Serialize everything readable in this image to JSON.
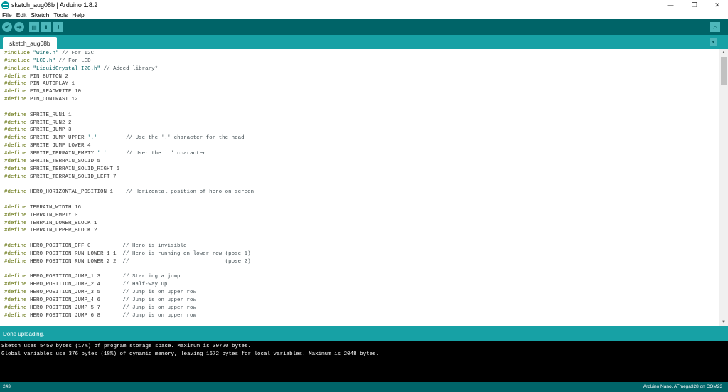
{
  "window": {
    "title": "sketch_aug08b | Arduino 1.8.2",
    "minimize_glyph": "—",
    "maximize_glyph": "❐",
    "close_glyph": "✕"
  },
  "menu": {
    "items": [
      "File",
      "Edit",
      "Sketch",
      "Tools",
      "Help"
    ]
  },
  "toolbar": {
    "verify_glyph": "✔",
    "upload_glyph": "➜",
    "new_glyph": "▤",
    "open_glyph": "⬆",
    "save_glyph": "⬇",
    "serial_glyph": "⌕"
  },
  "tabs": {
    "active": "sketch_aug08b",
    "menu_glyph": "▼"
  },
  "code_lines": [
    [
      [
        "kw",
        "#include"
      ],
      [
        "",
        " "
      ],
      [
        "str",
        "\"Wire.h\""
      ],
      [
        "",
        " "
      ],
      [
        "cm",
        "// For I2C"
      ]
    ],
    [
      [
        "kw",
        "#include"
      ],
      [
        "",
        " "
      ],
      [
        "str",
        "\"LCD.h\""
      ],
      [
        "",
        " "
      ],
      [
        "cm",
        "// For LCD"
      ]
    ],
    [
      [
        "kw",
        "#include"
      ],
      [
        "",
        " "
      ],
      [
        "str",
        "\"LiquidCrystal_I2C.h\""
      ],
      [
        "",
        " "
      ],
      [
        "cm",
        "// Added library*"
      ]
    ],
    [
      [
        "kw",
        "#define"
      ],
      [
        "",
        " PIN_BUTTON 2"
      ]
    ],
    [
      [
        "kw",
        "#define"
      ],
      [
        "",
        " PIN_AUTOPLAY 1"
      ]
    ],
    [
      [
        "kw",
        "#define"
      ],
      [
        "",
        " PIN_READWRITE 10"
      ]
    ],
    [
      [
        "kw",
        "#define"
      ],
      [
        "",
        " PIN_CONTRAST 12"
      ]
    ],
    [],
    [
      [
        "kw",
        "#define"
      ],
      [
        "",
        " SPRITE_RUN1 1"
      ]
    ],
    [
      [
        "kw",
        "#define"
      ],
      [
        "",
        " SPRITE_RUN2 2"
      ]
    ],
    [
      [
        "kw",
        "#define"
      ],
      [
        "",
        " SPRITE_JUMP 3"
      ]
    ],
    [
      [
        "kw",
        "#define"
      ],
      [
        "",
        " SPRITE_JUMP_UPPER "
      ],
      [
        "str",
        "'.'"
      ],
      [
        "",
        "         "
      ],
      [
        "cm",
        "// Use the '.' character for the head"
      ]
    ],
    [
      [
        "kw",
        "#define"
      ],
      [
        "",
        " SPRITE_JUMP_LOWER 4"
      ]
    ],
    [
      [
        "kw",
        "#define"
      ],
      [
        "",
        " SPRITE_TERRAIN_EMPTY "
      ],
      [
        "str",
        "' '"
      ],
      [
        "",
        "      "
      ],
      [
        "cm",
        "// User the ' ' character"
      ]
    ],
    [
      [
        "kw",
        "#define"
      ],
      [
        "",
        " SPRITE_TERRAIN_SOLID 5"
      ]
    ],
    [
      [
        "kw",
        "#define"
      ],
      [
        "",
        " SPRITE_TERRAIN_SOLID_RIGHT 6"
      ]
    ],
    [
      [
        "kw",
        "#define"
      ],
      [
        "",
        " SPRITE_TERRAIN_SOLID_LEFT 7"
      ]
    ],
    [],
    [
      [
        "kw",
        "#define"
      ],
      [
        "",
        " HERO_HORIZONTAL_POSITION 1    "
      ],
      [
        "cm",
        "// Horizontal position of hero on screen"
      ]
    ],
    [],
    [
      [
        "kw",
        "#define"
      ],
      [
        "",
        " TERRAIN_WIDTH 16"
      ]
    ],
    [
      [
        "kw",
        "#define"
      ],
      [
        "",
        " TERRAIN_EMPTY 0"
      ]
    ],
    [
      [
        "kw",
        "#define"
      ],
      [
        "",
        " TERRAIN_LOWER_BLOCK 1"
      ]
    ],
    [
      [
        "kw",
        "#define"
      ],
      [
        "",
        " TERRAIN_UPPER_BLOCK 2"
      ]
    ],
    [],
    [
      [
        "kw",
        "#define"
      ],
      [
        "",
        " HERO_POSITION_OFF 0          "
      ],
      [
        "cm",
        "// Hero is invisible"
      ]
    ],
    [
      [
        "kw",
        "#define"
      ],
      [
        "",
        " HERO_POSITION_RUN_LOWER_1 1  "
      ],
      [
        "cm",
        "// Hero is running on lower row (pose 1)"
      ]
    ],
    [
      [
        "kw",
        "#define"
      ],
      [
        "",
        " HERO_POSITION_RUN_LOWER_2 2  "
      ],
      [
        "cm",
        "//                              (pose 2)"
      ]
    ],
    [],
    [
      [
        "kw",
        "#define"
      ],
      [
        "",
        " HERO_POSITION_JUMP_1 3       "
      ],
      [
        "cm",
        "// Starting a jump"
      ]
    ],
    [
      [
        "kw",
        "#define"
      ],
      [
        "",
        " HERO_POSITION_JUMP_2 4       "
      ],
      [
        "cm",
        "// Half-way up"
      ]
    ],
    [
      [
        "kw",
        "#define"
      ],
      [
        "",
        " HERO_POSITION_JUMP_3 5       "
      ],
      [
        "cm",
        "// Jump is on upper row"
      ]
    ],
    [
      [
        "kw",
        "#define"
      ],
      [
        "",
        " HERO_POSITION_JUMP_4 6       "
      ],
      [
        "cm",
        "// Jump is on upper row"
      ]
    ],
    [
      [
        "kw",
        "#define"
      ],
      [
        "",
        " HERO_POSITION_JUMP_5 7       "
      ],
      [
        "cm",
        "// Jump is on upper row"
      ]
    ],
    [
      [
        "kw",
        "#define"
      ],
      [
        "",
        " HERO_POSITION_JUMP_6 8       "
      ],
      [
        "cm",
        "// Jump is on upper row"
      ]
    ]
  ],
  "status": {
    "message": "Done uploading."
  },
  "console": {
    "lines": [
      "Sketch uses 5450 bytes (17%) of program storage space. Maximum is 30720 bytes.",
      "Global variables use 376 bytes (18%) of dynamic memory, leaving 1672 bytes for local variables. Maximum is 2048 bytes."
    ]
  },
  "footer": {
    "line_number": "243",
    "board": "Arduino Nano, ATmega328 on COM23"
  },
  "scrollbar": {
    "up_glyph": "▲",
    "down_glyph": "▼"
  },
  "colors": {
    "teal_dark": "#006468",
    "teal": "#17a1a5",
    "keyword": "#5e6d03",
    "string": "#005c5f"
  }
}
